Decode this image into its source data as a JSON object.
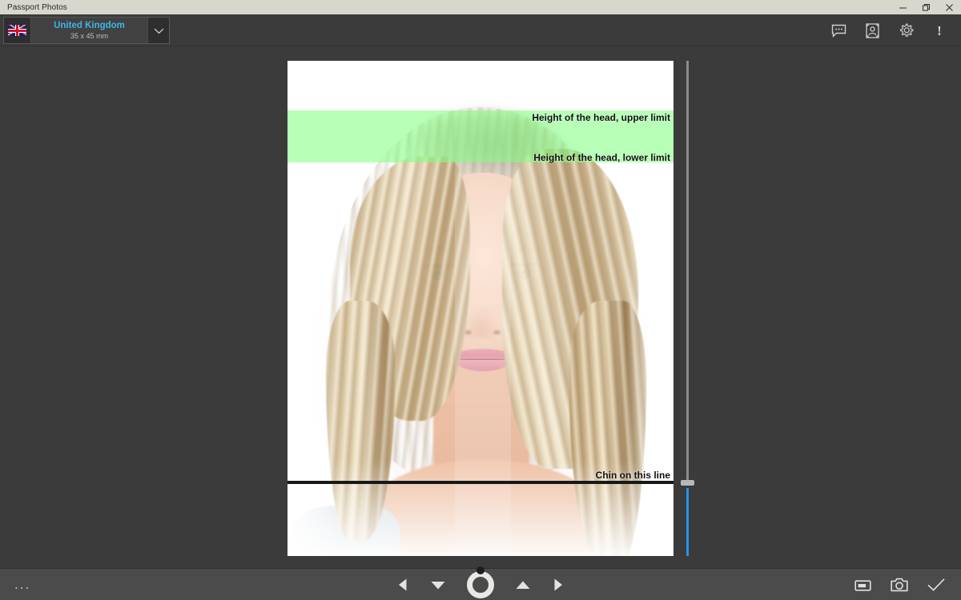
{
  "window": {
    "title": "Passport Photos",
    "controls": [
      {
        "name": "minimize",
        "glyph": "minimize-icon"
      },
      {
        "name": "maximize",
        "glyph": "maximize-icon"
      },
      {
        "name": "close",
        "glyph": "close-icon"
      }
    ]
  },
  "toolbar": {
    "country": {
      "flag_alt": "united-kingdom-flag",
      "name": "United Kingdom",
      "size": "35 x 45 mm",
      "caret": "chevron-down-icon"
    },
    "actions": [
      {
        "name": "comments",
        "icon": "speech-bubble-icon",
        "label": ""
      },
      {
        "name": "biometrics",
        "icon": "portrait-frame-icon",
        "label": ""
      },
      {
        "name": "settings",
        "icon": "gear-icon",
        "label": ""
      },
      {
        "name": "info",
        "icon": "exclamation-icon",
        "label": "!"
      }
    ]
  },
  "photo": {
    "guides": {
      "head_upper_limit": "Height of the head, upper limit",
      "head_lower_limit": "Height of the head, lower limit",
      "chin_line": "Chin on this line"
    },
    "band_color": "#84ff84",
    "chin_line_color": "#17181a"
  },
  "zoom_slider": {
    "name": "vertical-zoom-slider",
    "fill_color": "#2196f3",
    "track_color": "#8c8c8c",
    "value_percent": 94
  },
  "bottombar": {
    "overflow": "...",
    "controls": [
      {
        "name": "rotate-left-step",
        "icon": "triangle-left-icon"
      },
      {
        "name": "move-down",
        "icon": "triangle-down-icon"
      },
      {
        "name": "rotation-dial",
        "icon": "rotation-dial-icon"
      },
      {
        "name": "move-up",
        "icon": "triangle-up-icon"
      },
      {
        "name": "rotate-right-step",
        "icon": "triangle-right-icon"
      }
    ],
    "actions": [
      {
        "name": "open-image",
        "icon": "open-folder-icon"
      },
      {
        "name": "take-photo",
        "icon": "camera-icon"
      },
      {
        "name": "confirm",
        "icon": "check-icon"
      }
    ]
  },
  "colors": {
    "app_background": "#3b3b3b",
    "titlebar": "#d9d6ce",
    "bottombar": "#4b4b4b",
    "accent": "#3fb4e8"
  }
}
